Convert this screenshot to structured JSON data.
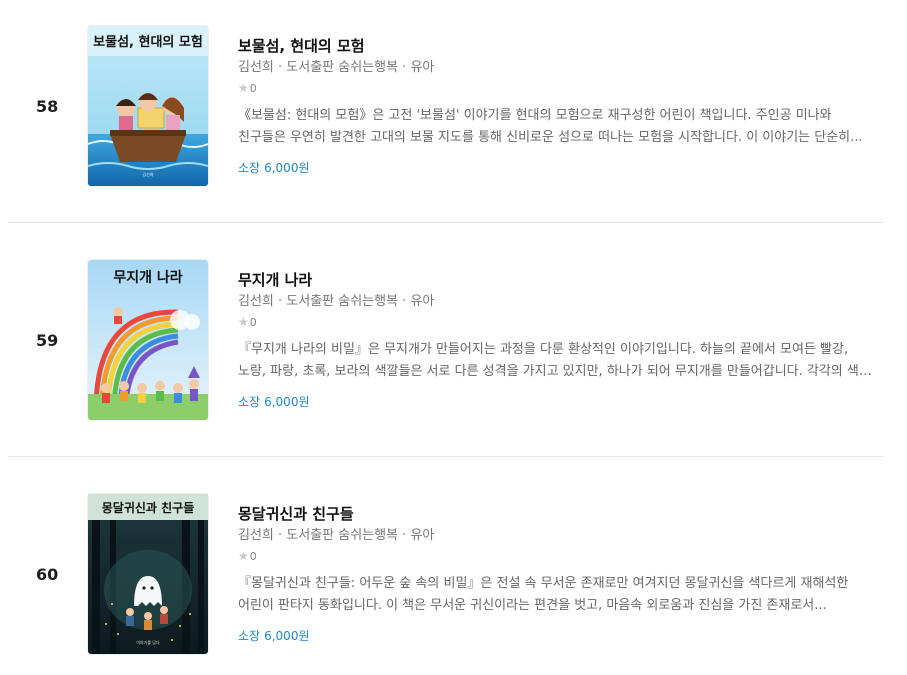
{
  "books": [
    {
      "rank": "58",
      "cover_title": "보물섬, 현대의 모험",
      "title": "보물섬, 현대의 모험",
      "meta": "김선희 · 도서출판 숨쉬는행복 · 유아",
      "rating": "0",
      "desc_line1": "《보물섬: 현대의 모험》은 고전 '보물섬' 이야기를 현대의 모험으로 재구성한 어린이 책입니다. 주인공 미나와",
      "desc_line2": "친구들은 우연히 발견한 고대의 보물 지도를 통해 신비로운 섬으로 떠나는 모험을 시작합니다. 이 이야기는 단순히...",
      "price_label": "소장",
      "price_value": "6,000원"
    },
    {
      "rank": "59",
      "cover_title": "무지개 나라",
      "title": "무지개 나라",
      "meta": "김선희 · 도서출판 숨쉬는행복 · 유아",
      "rating": "0",
      "desc_line1": "『무지개 나라의 비밀』은 무지개가 만들어지는 과정을 다룬 환상적인 이야기입니다. 하늘의 끝에서 모여든 빨강,",
      "desc_line2": "노랑, 파랑, 초록, 보라의 색깔들은 서로 다른 성격을 가지고 있지만, 하나가 되어 무지개를 만들어갑니다. 각각의 색깔...",
      "price_label": "소장",
      "price_value": "6,000원"
    },
    {
      "rank": "60",
      "cover_title": "몽달귀신과 친구들",
      "title": "몽달귀신과 친구들",
      "meta": "김선희 · 도서출판 숨쉬는행복 · 유아",
      "rating": "0",
      "desc_line1": "『몽달귀신과 친구들: 어두운 숲 속의 비밀』은 전설 속 무서운 존재로만 여겨지던 몽달귀신을 색다르게 재해석한",
      "desc_line2": "어린이 판타지 동화입니다. 이 책은 무서운 귀신이라는 편견을 벗고, 마음속 외로움과 진심을 가진 존재로서...",
      "price_label": "소장",
      "price_value": "6,000원"
    }
  ],
  "colors": {
    "accent": "#1e88c7",
    "star": "#c8c8c8",
    "divider": "#e6e6e6"
  },
  "icons": {
    "rating": "star-icon"
  }
}
